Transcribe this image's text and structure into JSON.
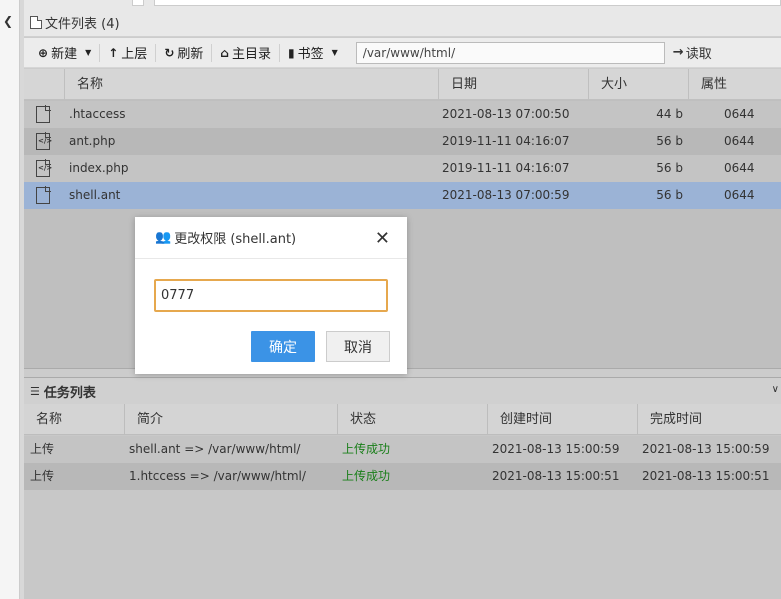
{
  "file_panel": {
    "title": "文件列表 (4)",
    "toolbar": {
      "new_label": "新建",
      "up_label": "上层",
      "refresh_label": "刷新",
      "home_label": "主目录",
      "bookmark_label": "书签",
      "path_value": "/var/www/html/",
      "read_label": "读取"
    },
    "columns": [
      "名称",
      "日期",
      "大小",
      "属性"
    ],
    "files": [
      {
        "name": ".htaccess",
        "date": "2021-08-13 07:00:50",
        "size": "44 b",
        "perm": "0644",
        "icon": "file-icon"
      },
      {
        "name": "ant.php",
        "date": "2019-11-11 04:16:07",
        "size": "56 b",
        "perm": "0644",
        "icon": "code-file-icon"
      },
      {
        "name": "index.php",
        "date": "2019-11-11 04:16:07",
        "size": "56 b",
        "perm": "0644",
        "icon": "code-file-icon"
      },
      {
        "name": "shell.ant",
        "date": "2021-08-13 07:00:59",
        "size": "56 b",
        "perm": "0644",
        "icon": "file-icon",
        "selected": true
      }
    ]
  },
  "task_panel": {
    "title": "任务列表",
    "columns": [
      "名称",
      "简介",
      "状态",
      "创建时间",
      "完成时间"
    ],
    "tasks": [
      {
        "name": "上传",
        "desc": "shell.ant => /var/www/html/",
        "status": "上传成功",
        "created": "2021-08-13 15:00:59",
        "finished": "2021-08-13 15:00:59"
      },
      {
        "name": "上传",
        "desc": "1.htccess => /var/www/html/",
        "status": "上传成功",
        "created": "2021-08-13 15:00:51",
        "finished": "2021-08-13 15:00:51"
      }
    ]
  },
  "modal": {
    "title": "更改权限 (shell.ant)",
    "input_value": "0777",
    "ok_label": "确定",
    "cancel_label": "取消"
  },
  "colors": {
    "selected_row": "#9bb3d6",
    "accent": "#3b93e6",
    "success": "#1a7f1a"
  }
}
